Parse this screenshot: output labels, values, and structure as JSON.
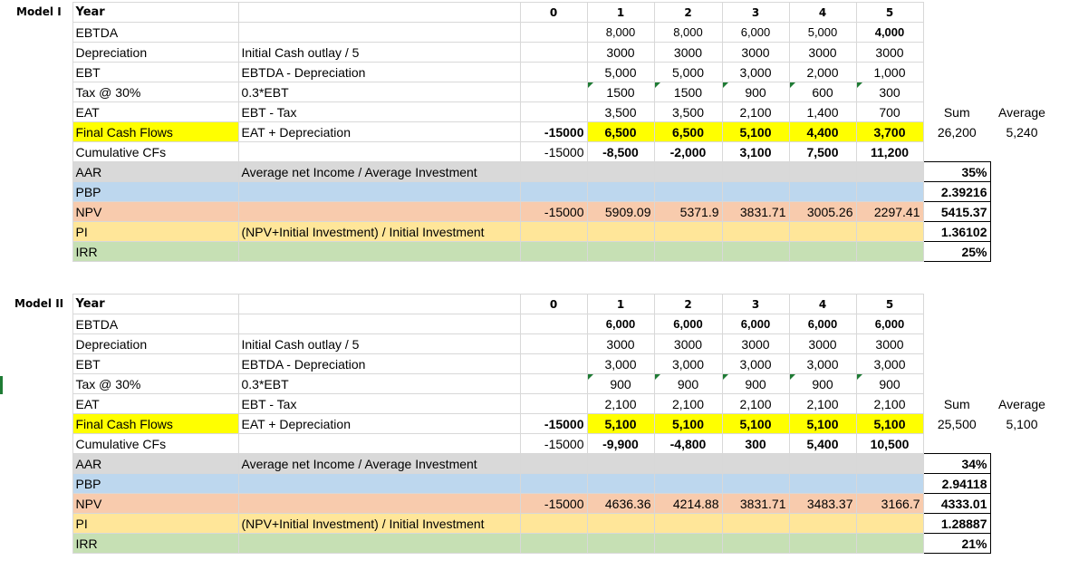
{
  "models": [
    {
      "title": "Model I",
      "year_label": "Year",
      "years": [
        "0",
        "1",
        "2",
        "3",
        "4",
        "5"
      ],
      "rows": {
        "ebtda": {
          "label": "EBTDA",
          "formula": "",
          "y0": "",
          "v": [
            "8,000",
            "8,000",
            "6,000",
            "5,000",
            "4,000"
          ]
        },
        "depreciation": {
          "label": "Depreciation",
          "formula": "Initial Cash outlay / 5",
          "y0": "",
          "v": [
            "3000",
            "3000",
            "3000",
            "3000",
            "3000"
          ]
        },
        "ebt": {
          "label": "EBT",
          "formula": "EBTDA - Depreciation",
          "y0": "",
          "v": [
            "5,000",
            "5,000",
            "3,000",
            "2,000",
            "1,000"
          ]
        },
        "tax": {
          "label": "Tax @ 30%",
          "formula": "0.3*EBT",
          "y0": "",
          "v": [
            "1500",
            "1500",
            "900",
            "600",
            "300"
          ]
        },
        "eat": {
          "label": "EAT",
          "formula": "EBT - Tax",
          "y0": "",
          "v": [
            "3,500",
            "3,500",
            "2,100",
            "1,400",
            "700"
          ]
        },
        "fcf": {
          "label": "Final Cash Flows",
          "formula": "EAT + Depreciation",
          "y0": "-15000",
          "v": [
            "6,500",
            "6,500",
            "5,100",
            "4,400",
            "3,700"
          ]
        },
        "cumcf": {
          "label": "Cumulative CFs",
          "formula": "",
          "y0": "-15000",
          "v": [
            "-8,500",
            "-2,000",
            "3,100",
            "7,500",
            "11,200"
          ]
        },
        "aar": {
          "label": "AAR",
          "formula": "Average net Income / Average Investment",
          "result": "35%"
        },
        "pbp": {
          "label": "PBP",
          "formula": "",
          "result": "2.39216"
        },
        "npv": {
          "label": "NPV",
          "formula": "",
          "y0": "-15000",
          "v": [
            "5909.09",
            "5371.9",
            "3831.71",
            "3005.26",
            "2297.41"
          ],
          "result": "5415.37"
        },
        "pi": {
          "label": "PI",
          "formula": "(NPV+Initial Investment) / Initial Investment",
          "result": "1.36102"
        },
        "irr": {
          "label": "IRR",
          "formula": "",
          "result": "25%"
        }
      },
      "sum_label": "Sum",
      "avg_label": "Average",
      "sum_value": "26,200",
      "avg_value": "5,240"
    },
    {
      "title": "Model II",
      "year_label": "Year",
      "years": [
        "0",
        "1",
        "2",
        "3",
        "4",
        "5"
      ],
      "rows": {
        "ebtda": {
          "label": "EBTDA",
          "formula": "",
          "y0": "",
          "v": [
            "6,000",
            "6,000",
            "6,000",
            "6,000",
            "6,000"
          ]
        },
        "depreciation": {
          "label": "Depreciation",
          "formula": "Initial Cash outlay / 5",
          "y0": "",
          "v": [
            "3000",
            "3000",
            "3000",
            "3000",
            "3000"
          ]
        },
        "ebt": {
          "label": "EBT",
          "formula": "EBTDA - Depreciation",
          "y0": "",
          "v": [
            "3,000",
            "3,000",
            "3,000",
            "3,000",
            "3,000"
          ]
        },
        "tax": {
          "label": "Tax @ 30%",
          "formula": "0.3*EBT",
          "y0": "",
          "v": [
            "900",
            "900",
            "900",
            "900",
            "900"
          ]
        },
        "eat": {
          "label": "EAT",
          "formula": "EBT - Tax",
          "y0": "",
          "v": [
            "2,100",
            "2,100",
            "2,100",
            "2,100",
            "2,100"
          ]
        },
        "fcf": {
          "label": "Final Cash Flows",
          "formula": "EAT + Depreciation",
          "y0": "-15000",
          "v": [
            "5,100",
            "5,100",
            "5,100",
            "5,100",
            "5,100"
          ]
        },
        "cumcf": {
          "label": "Cumulative CFs",
          "formula": "",
          "y0": "-15000",
          "v": [
            "-9,900",
            "-4,800",
            "300",
            "5,400",
            "10,500"
          ]
        },
        "aar": {
          "label": "AAR",
          "formula": "Average net Income / Average Investment",
          "result": "34%"
        },
        "pbp": {
          "label": "PBP",
          "formula": "",
          "result": "2.94118"
        },
        "npv": {
          "label": "NPV",
          "formula": "",
          "y0": "-15000",
          "v": [
            "4636.36",
            "4214.88",
            "3831.71",
            "3483.37",
            "3166.7"
          ],
          "result": "4333.01"
        },
        "pi": {
          "label": "PI",
          "formula": "(NPV+Initial Investment) / Initial Investment",
          "result": "1.28887"
        },
        "irr": {
          "label": "IRR",
          "formula": "",
          "result": "21%"
        }
      },
      "sum_label": "Sum",
      "avg_label": "Average",
      "sum_value": "25,500",
      "avg_value": "5,100"
    }
  ]
}
